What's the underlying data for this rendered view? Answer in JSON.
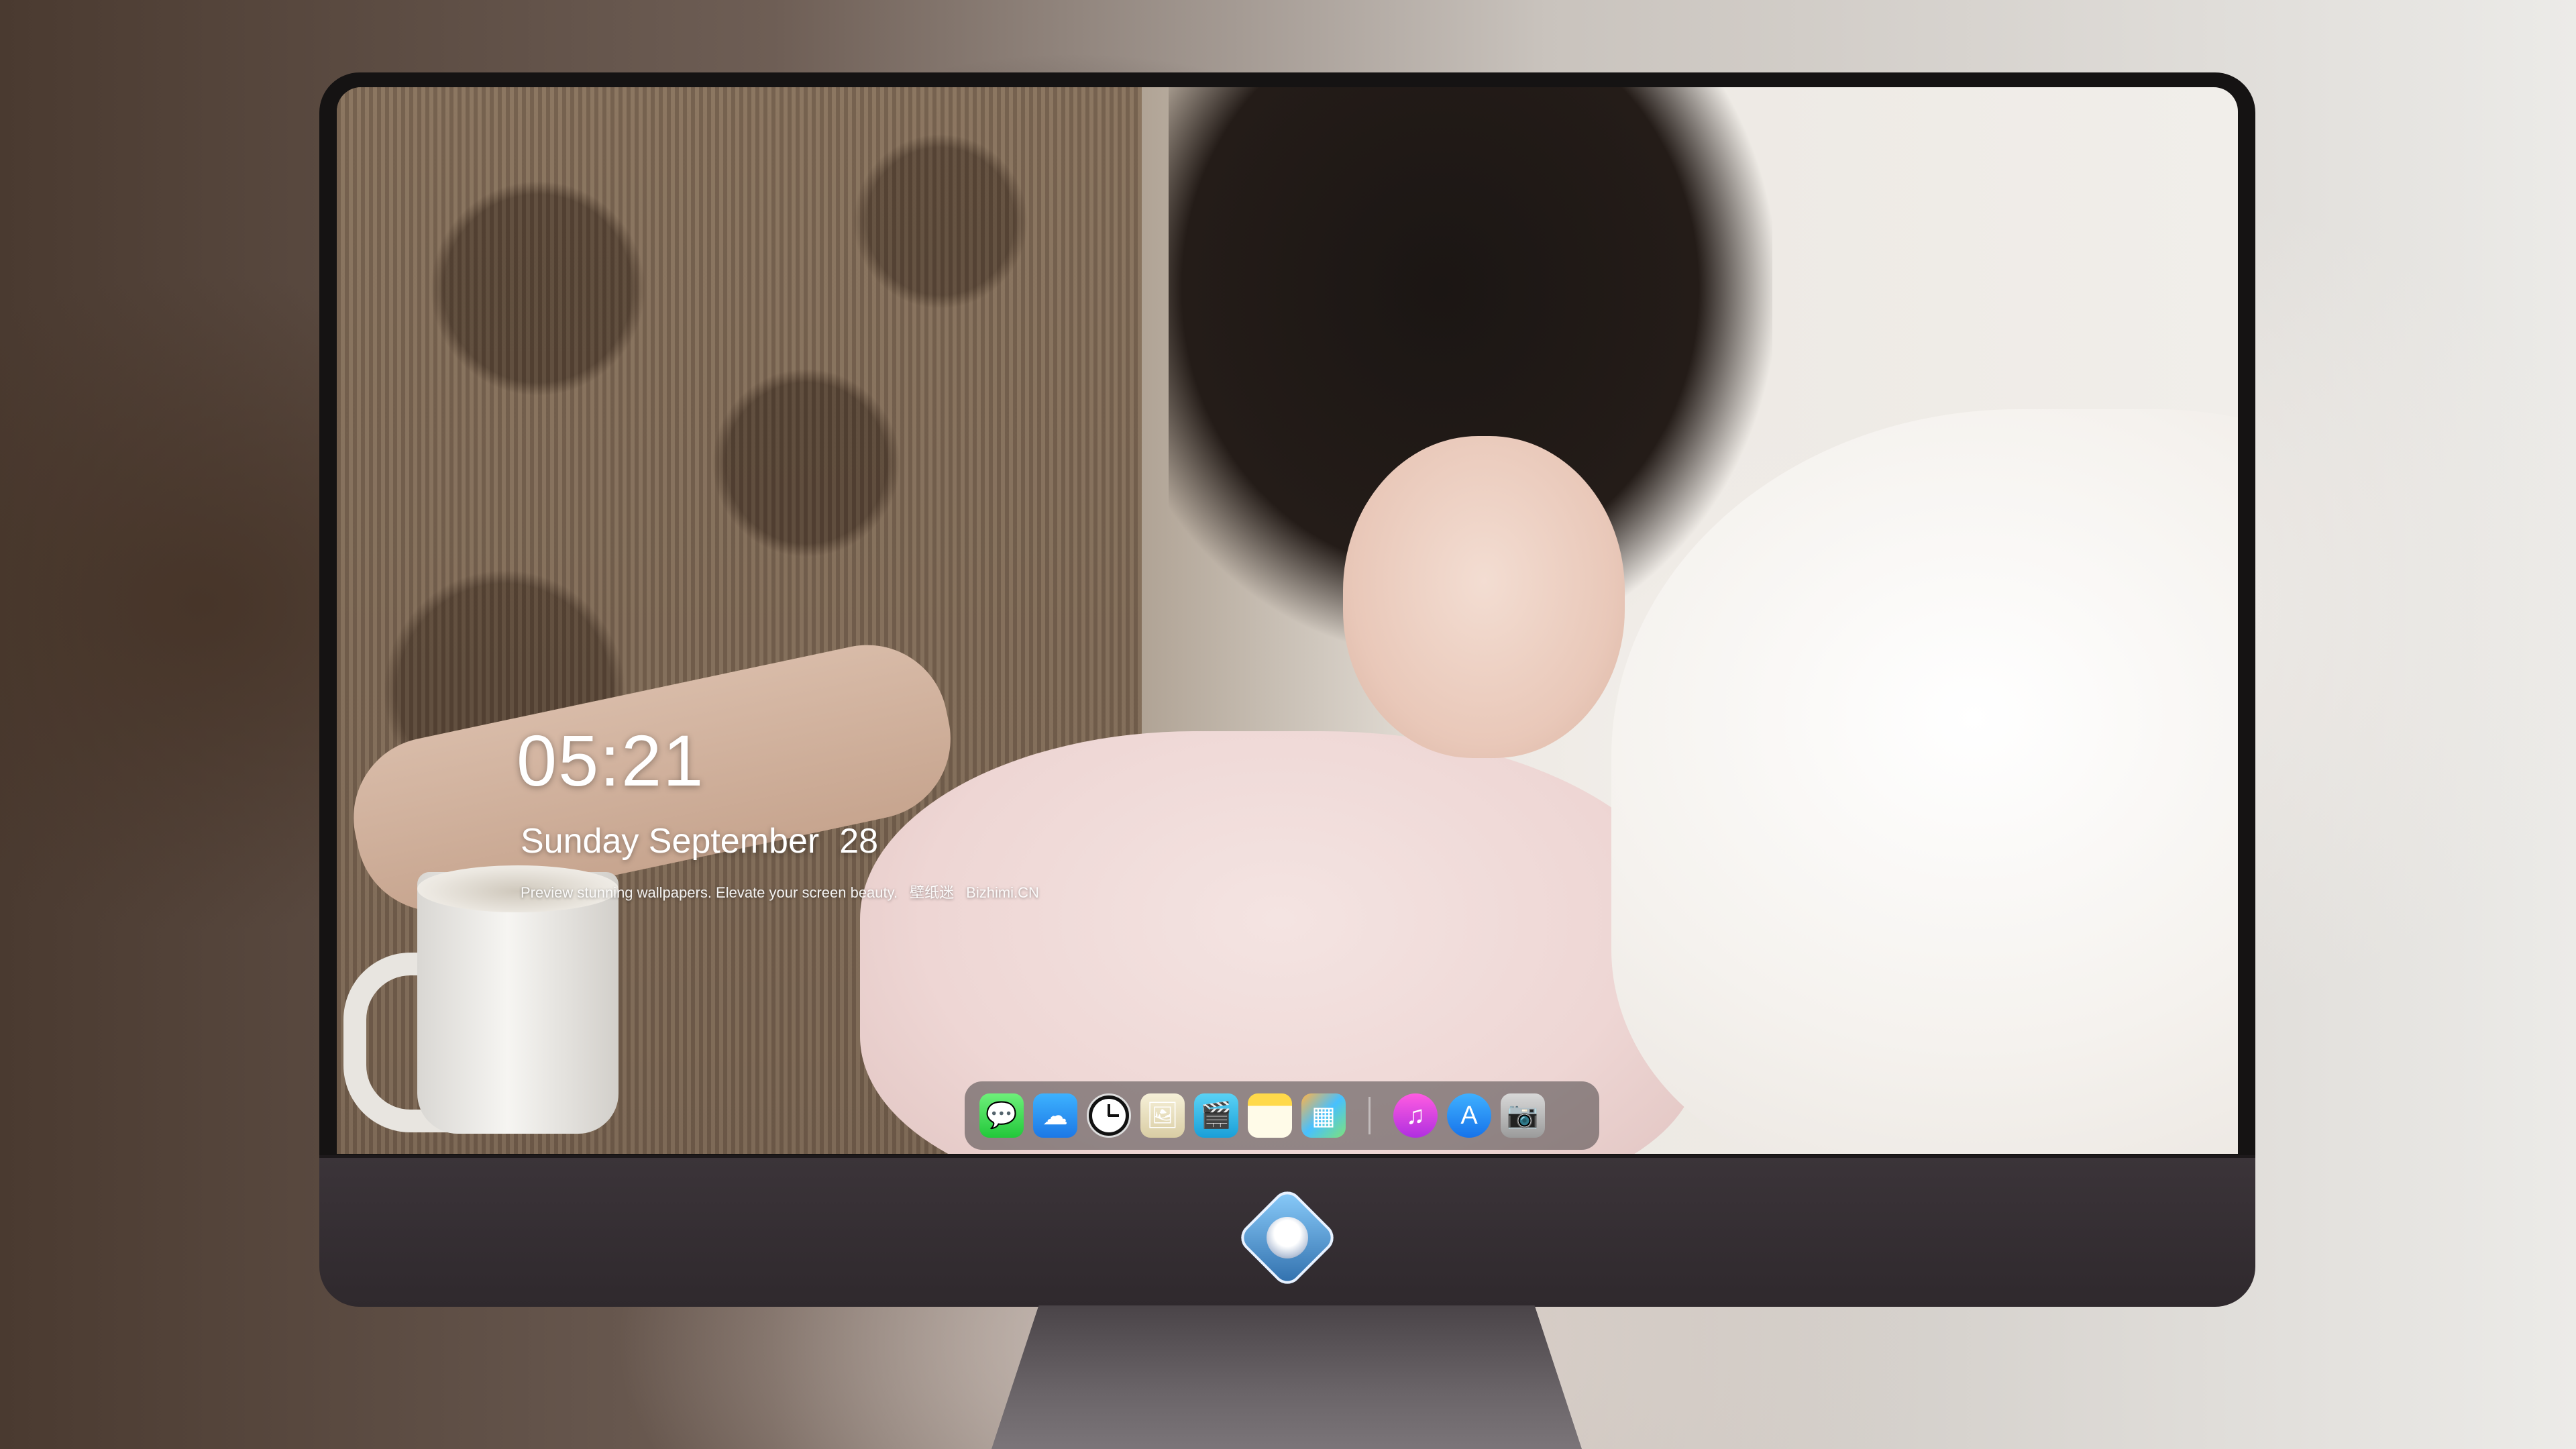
{
  "lockscreen": {
    "time": "05:21",
    "day": "Sunday September",
    "date": "28",
    "tagline": {
      "text": "Preview stunning wallpapers. Elevate your screen beauty.",
      "brand_cn": "壁纸迷",
      "brand": "Bizhimi.CN"
    }
  },
  "dock": {
    "apps": [
      {
        "name": "messages-icon",
        "glyph": "💬"
      },
      {
        "name": "weather-icon",
        "glyph": "☁"
      },
      {
        "name": "clock-icon",
        "glyph": ""
      },
      {
        "name": "preview-icon",
        "glyph": "🖼"
      },
      {
        "name": "clips-icon",
        "glyph": "🎬"
      },
      {
        "name": "notes-icon",
        "glyph": ""
      },
      {
        "name": "photos-icon",
        "glyph": "▦"
      }
    ],
    "pinned": [
      {
        "name": "music-icon",
        "glyph": "♫"
      },
      {
        "name": "app-store-icon",
        "glyph": "A"
      },
      {
        "name": "camera-icon",
        "glyph": "📷"
      }
    ]
  },
  "colors": {
    "bezel": "#151313",
    "chin": "#3b3439",
    "dock_bg": "rgba(70,66,68,0.55)",
    "clock_text": "#ffffff"
  }
}
